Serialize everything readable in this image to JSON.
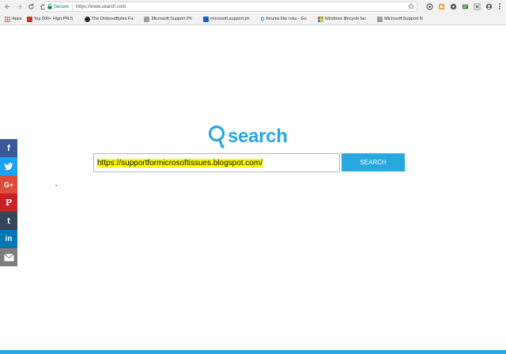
{
  "browser": {
    "secure_label": "Secure",
    "url": "https://www.search.com"
  },
  "bookmarks": [
    {
      "label": "Apps",
      "color": "#7a7a7a"
    },
    {
      "label": "Top 500+ High PR S",
      "color": "#c0392b"
    },
    {
      "label": "The OrderedBytes Fa",
      "color": "#2b2b2b"
    },
    {
      "label": "Microsoft Support Ph",
      "color": "#9e9e9e"
    },
    {
      "label": "microsoft support ph",
      "color": "#1565c0"
    },
    {
      "label": "forums like roku - Go",
      "color": "#4285f4"
    },
    {
      "label": "Windows lifecycle fac",
      "color": "#f25022"
    },
    {
      "label": "Microsoft Support N",
      "color": "#9e9e9e"
    }
  ],
  "logo": {
    "text": "search",
    "color": "#29a8e0"
  },
  "search": {
    "value": "https://supportformicrosoftissues.blogspot.com/",
    "button_label": "SEARCH"
  },
  "share": [
    {
      "icon": "facebook-icon",
      "glyph": "f",
      "color": "#3b5998"
    },
    {
      "icon": "twitter-icon",
      "glyph": "t",
      "color": "#1da1f2"
    },
    {
      "icon": "google-plus-icon",
      "glyph": "G+",
      "color": "#dd4b39"
    },
    {
      "icon": "pinterest-icon",
      "glyph": "P",
      "color": "#cb2027"
    },
    {
      "icon": "tumblr-icon",
      "glyph": "t",
      "color": "#35465c"
    },
    {
      "icon": "linkedin-icon",
      "glyph": "in",
      "color": "#0077b5"
    },
    {
      "icon": "email-icon",
      "glyph": "✉",
      "color": "#7d7d7d"
    }
  ]
}
